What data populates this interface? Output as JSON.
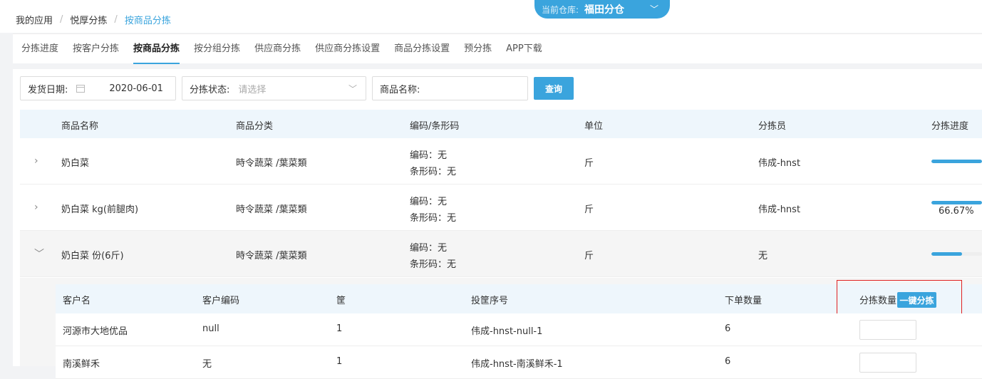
{
  "breadcrumb": [
    "我的应用",
    "悦厚分拣",
    "按商品分拣"
  ],
  "warehouse": {
    "label": "当前仓库:",
    "value": "福田分仓"
  },
  "tabs": [
    "分拣进度",
    "按客户分拣",
    "按商品分拣",
    "按分组分拣",
    "供应商分拣",
    "供应商分拣设置",
    "商品分拣设置",
    "预分拣",
    "APP下载"
  ],
  "filters": {
    "date_label": "发货日期:",
    "date_value": "2020-06-01",
    "status_label": "分拣状态:",
    "status_placeholder": "请选择",
    "name_label": "商品名称:",
    "query_button": "查询"
  },
  "table": {
    "headers": [
      "商品名称",
      "商品分类",
      "编码/条形码",
      "单位",
      "分拣员",
      "分拣进度"
    ],
    "rows": [
      {
        "name": "奶白菜",
        "category": "時令蔬菜 /葉菜類",
        "code": "编码：无",
        "barcode": "条形码：无",
        "unit": "斤",
        "sorter": "伟成-hnst",
        "progress": 1.0,
        "progress_text": ""
      },
      {
        "name": "奶白菜 kg(前腿肉)",
        "category": "時令蔬菜 /葉菜類",
        "code": "编码：无",
        "barcode": "条形码：无",
        "unit": "斤",
        "sorter": "伟成-hnst",
        "progress": 1.0,
        "progress_text": "66.67%"
      },
      {
        "name": "奶白菜 份(6斤)",
        "category": "時令蔬菜 /葉菜類",
        "code": "编码：无",
        "barcode": "条形码：无",
        "unit": "斤",
        "sorter": "无",
        "progress": 0.6,
        "progress_text": ""
      }
    ]
  },
  "subtable": {
    "headers": [
      "客户名",
      "客户编码",
      "筐",
      "投筐序号",
      "下单数量",
      "分拣数量"
    ],
    "onekey_button": "一键分拣",
    "rows": [
      {
        "customer": "河源市大地优品",
        "code": "null",
        "basket": "1",
        "seq": "伟成-hnst-null-1",
        "qty": "6"
      },
      {
        "customer": "南溪鲜禾",
        "code": "无",
        "basket": "1",
        "seq": "伟成-hnst-南溪鲜禾-1",
        "qty": "6"
      }
    ]
  }
}
